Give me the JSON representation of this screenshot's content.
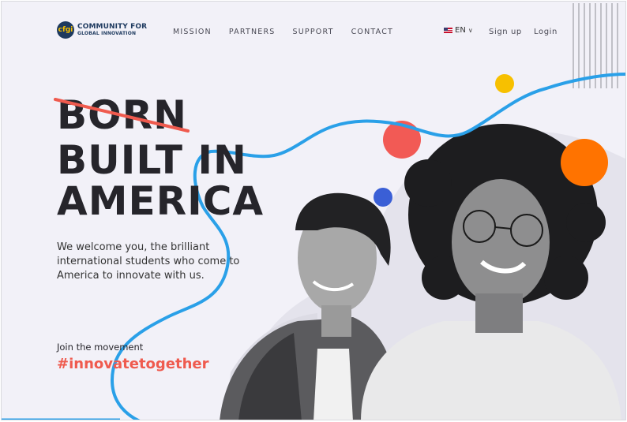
{
  "brand": {
    "logo_mark": "cfgi",
    "name_line1": "COMMUNITY FOR",
    "name_line2": "GLOBAL INNOVATION"
  },
  "nav": {
    "items": [
      "MISSION",
      "PARTNERS",
      "SUPPORT",
      "CONTACT"
    ]
  },
  "header": {
    "language": "EN",
    "language_flag": "us-flag-icon",
    "signup_label": "Sign up",
    "login_label": "Login"
  },
  "hero": {
    "struck_word": "BORN",
    "line2": "BUILT IN",
    "line3": "AMERICA",
    "intro": "We welcome you, the brilliant international students who come to America to innovate with us.",
    "join_label": "Join the movement",
    "hashtag": "#innovatetogether"
  },
  "colors": {
    "background": "#f2f1f8",
    "text_dark": "#26252b",
    "accent_red": "#ef5a4e",
    "curve_blue": "#2aa0e8",
    "dot_yellow": "#f7c000",
    "dot_orange": "#ff7300",
    "dot_blue": "#3a5fd6",
    "brand_navy": "#1e3a5f"
  }
}
